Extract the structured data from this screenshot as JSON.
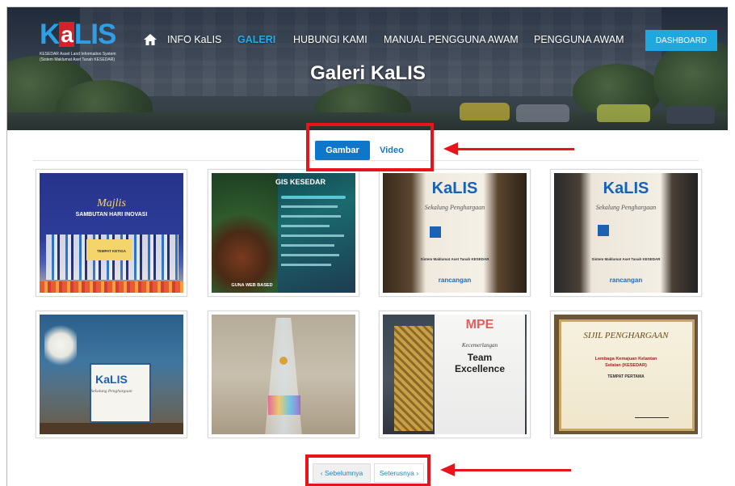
{
  "logo": {
    "wordmark_k": "K",
    "wordmark_a": "a",
    "wordmark_rest": "LIS",
    "subtitle_line1": "KESEDAR Asset Land Information System",
    "subtitle_line2": "(Sistem Maklumat Aset Tanah KESEDAR)"
  },
  "nav": {
    "home_icon": "home-icon",
    "items": [
      {
        "label": "INFO KaLIS",
        "active": false
      },
      {
        "label": "GALERI",
        "active": true
      },
      {
        "label": "HUBUNGI KAMI",
        "active": false
      },
      {
        "label": "MANUAL PENGGUNA AWAM",
        "active": false
      },
      {
        "label": "PENGGUNA AWAM",
        "active": false
      }
    ],
    "dashboard_label": "DASHBOARD"
  },
  "page": {
    "title": "Galeri KaLIS"
  },
  "tabs": [
    {
      "label": "Gambar",
      "active": true
    },
    {
      "label": "Video",
      "active": false
    }
  ],
  "gallery": [
    {
      "title": "Majlis",
      "subtitle": "SAMBUTAN HARI INOVASI",
      "sign": "TEMPAT KETIGA"
    },
    {
      "title": "GIS KESEDAR",
      "label": "GUNA WEB BASED"
    },
    {
      "brand": "KaLIS",
      "script": "Sekalung Penghargaan",
      "system": "Sistem Maklumat Aset Tanah KESEDAR",
      "footer": "rancangan"
    },
    {
      "brand": "KaLIS",
      "script": "Sekalung Penghargaan",
      "system": "Sistem Maklumat Aset Tanah KESEDAR",
      "footer": "rancangan"
    },
    {
      "brand": "KaLIS",
      "script": "Sekalung Penghargaan"
    },
    {
      "label": ""
    },
    {
      "brand": "MPE",
      "script": "Kecemerlangan",
      "title1": "Team",
      "title2": "Excellence"
    },
    {
      "title": "SIJIL PENGHARGAAN",
      "org1": "Lembaga Kemajuan Kelantan",
      "org2": "Selatan (KESEDAR)",
      "place": "TEMPAT PERTAMA"
    }
  ],
  "pagination": {
    "prev": "‹ Sebelumnya",
    "next": "Seterusnya ›"
  },
  "colors": {
    "accent": "#1fa8e0",
    "tab_active": "#0f77c9",
    "annotation": "#e8131b"
  }
}
